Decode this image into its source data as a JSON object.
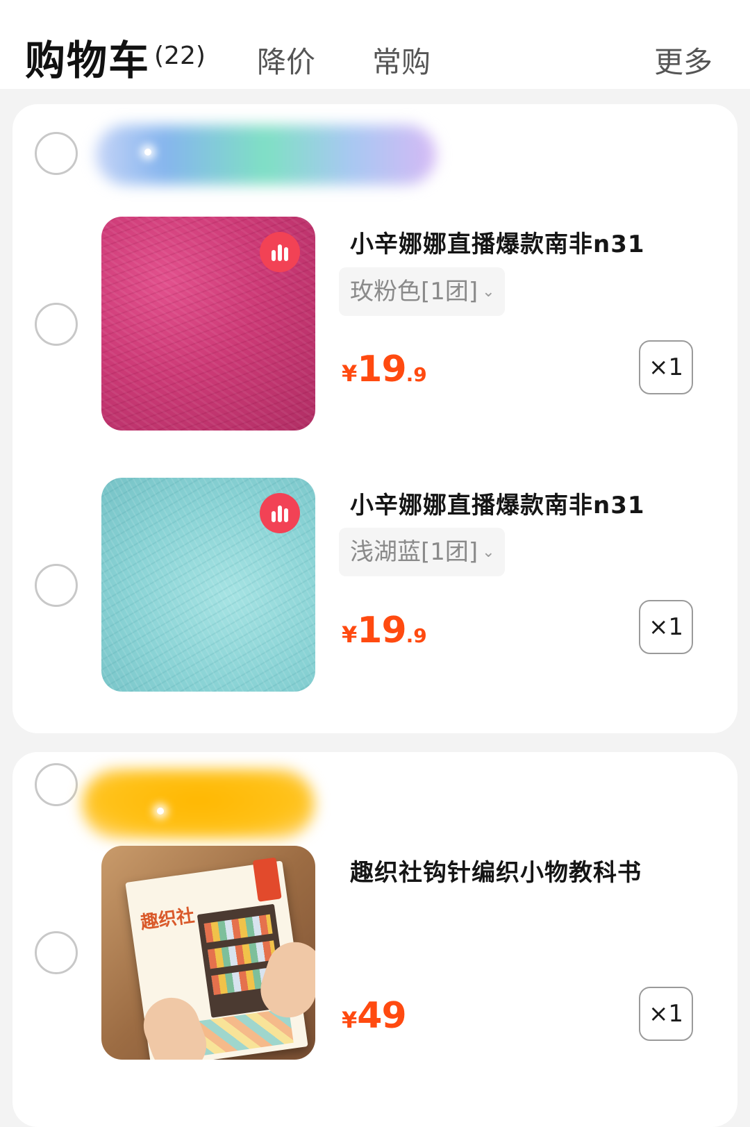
{
  "header": {
    "title": "购物车",
    "count": "(22)",
    "tabs": [
      "降价",
      "常购"
    ],
    "more": "更多"
  },
  "shops": [
    {
      "items": [
        {
          "name": "小辛娜娜直播爆款南非n31",
          "spec": "玫粉色[1团]",
          "price_yen": "¥",
          "price_int": "19",
          "price_dec": ".9",
          "qty": "×1",
          "image": "rose-pink-mohair-yarn",
          "badge_icon": "live-stream-icon"
        },
        {
          "name": "小辛娜娜直播爆款南非n31",
          "spec": "浅湖蓝[1团]",
          "price_yen": "¥",
          "price_int": "19",
          "price_dec": ".9",
          "qty": "×1",
          "image": "light-lake-blue-mohair-yarn",
          "badge_icon": "live-stream-icon"
        }
      ]
    },
    {
      "items": [
        {
          "name": "趣织社钩针编织小物教科书",
          "price_yen": "¥",
          "price_int": "49",
          "price_dec": "",
          "qty": "×1",
          "image": "crochet-book-cover",
          "book_title": "趣织社"
        }
      ]
    }
  ],
  "colors": {
    "price": "#ff4a10",
    "live_badge": "#f24255",
    "background": "#f3f3f3"
  },
  "icons": {
    "spec_caret": "chevron-down-icon"
  }
}
